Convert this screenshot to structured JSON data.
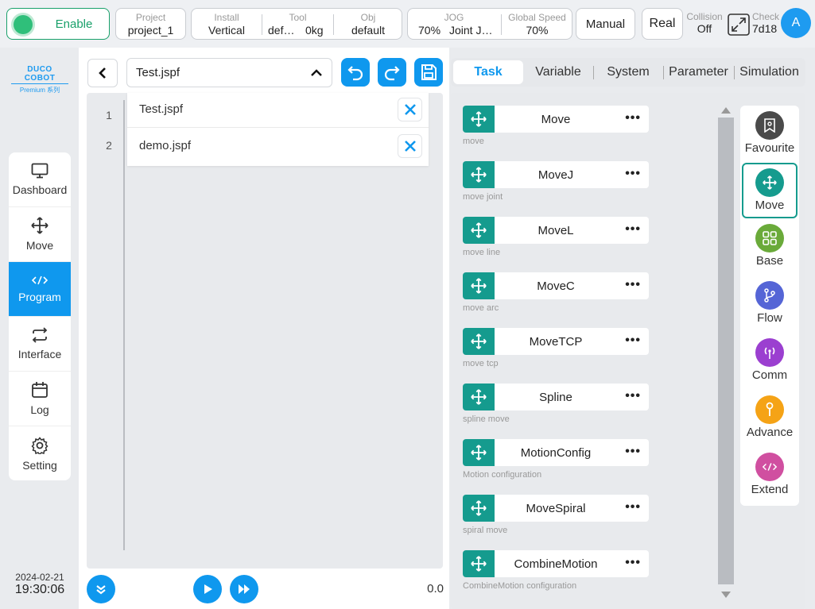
{
  "topbar": {
    "enable_label": "Enable",
    "project": {
      "label": "Project",
      "value": "project_1"
    },
    "install": {
      "label": "Install",
      "value": "Vertical"
    },
    "tool": {
      "label": "Tool",
      "name": "def…",
      "load": "0kg"
    },
    "obj": {
      "label": "Obj",
      "value": "default"
    },
    "jog": {
      "label": "JOG",
      "percent": "70%",
      "mode": "Joint J…"
    },
    "global_speed": {
      "label": "Global Speed",
      "value": "70%"
    },
    "manual_label": "Manual",
    "real_label": "Real",
    "collision": {
      "label": "Collision",
      "value": "Off"
    },
    "check": {
      "label": "Check",
      "value": "7d18"
    },
    "avatar_letter": "A"
  },
  "logo": {
    "line1": "DUCO COBOT",
    "line2": "Premium 系列"
  },
  "sidebar": {
    "items": [
      {
        "label": "Dashboard",
        "icon": "monitor-icon"
      },
      {
        "label": "Move",
        "icon": "move-icon"
      },
      {
        "label": "Program",
        "icon": "code-icon",
        "active": true
      },
      {
        "label": "Interface",
        "icon": "swap-icon"
      },
      {
        "label": "Log",
        "icon": "calendar-icon"
      },
      {
        "label": "Setting",
        "icon": "gear-icon"
      }
    ],
    "date": "2024-02-21",
    "time": "19:30:06"
  },
  "editor": {
    "current_file": "Test.jspf",
    "line_numbers": [
      "1",
      "2"
    ],
    "open_files": [
      "Test.jspf",
      "demo.jspf"
    ],
    "speed_value": "0.0"
  },
  "tabs": [
    "Task",
    "Variable",
    "System",
    "Parameter",
    "Simulation"
  ],
  "commands": [
    {
      "name": "Move",
      "desc": "move"
    },
    {
      "name": "MoveJ",
      "desc": "move joint"
    },
    {
      "name": "MoveL",
      "desc": "move line"
    },
    {
      "name": "MoveC",
      "desc": "move arc"
    },
    {
      "name": "MoveTCP",
      "desc": "move tcp"
    },
    {
      "name": "Spline",
      "desc": "spline move"
    },
    {
      "name": "MotionConfig",
      "desc": "Motion configuration"
    },
    {
      "name": "MoveSpiral",
      "desc": "spiral move"
    },
    {
      "name": "CombineMotion",
      "desc": "CombineMotion configuration"
    }
  ],
  "categories": [
    {
      "label": "Favourite",
      "color": "#4a4a4a",
      "icon": "bookmark-icon"
    },
    {
      "label": "Move",
      "color": "#159b8e",
      "icon": "move-icon",
      "active": true
    },
    {
      "label": "Base",
      "color": "#6aaa3a",
      "icon": "grid-icon"
    },
    {
      "label": "Flow",
      "color": "#5565d6",
      "icon": "branch-icon"
    },
    {
      "label": "Comm",
      "color": "#9b3fd0",
      "icon": "antenna-icon"
    },
    {
      "label": "Advance",
      "color": "#f5a316",
      "icon": "wrench-icon"
    },
    {
      "label": "Extend",
      "color": "#d04fa0",
      "icon": "code-icon"
    }
  ],
  "colors": {
    "accent": "#0f98ee",
    "teal": "#159b8e",
    "enable_green": "#19a06a"
  }
}
